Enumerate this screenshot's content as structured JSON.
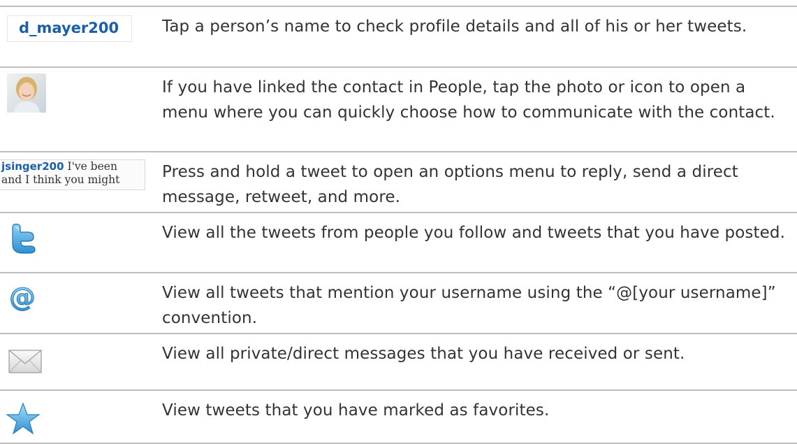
{
  "rows": [
    {
      "icon": "username-label",
      "icon_text": "d_mayer200",
      "text": "Tap a person’s name to check profile details and all of his or her tweets."
    },
    {
      "icon": "profile-photo-icon",
      "text": "If you have linked the contact in People, tap the photo or icon to open a menu where you can quickly choose how to communicate with the contact."
    },
    {
      "icon": "tweet-snippet",
      "tweet_user": "jsinger200",
      "tweet_line1": " I've been",
      "tweet_line2": "and I think you might",
      "text": "Press and hold a tweet to open an options menu to reply, send a direct message, retweet, and more."
    },
    {
      "icon": "twitter-bird-icon",
      "text": "View all the tweets from people you follow and tweets that you have posted."
    },
    {
      "icon": "at-mention-icon",
      "text": "View all tweets that mention your username using the “@[your username]” convention."
    },
    {
      "icon": "envelope-icon",
      "text": "View all private/direct messages that you have received or sent."
    },
    {
      "icon": "star-icon",
      "text": "View tweets that you have marked as favorites."
    }
  ],
  "colors": {
    "link_blue": "#1a5fa8",
    "icon_blue": "#4aa3df",
    "divider": "#bdbdbd",
    "text": "#333333"
  }
}
